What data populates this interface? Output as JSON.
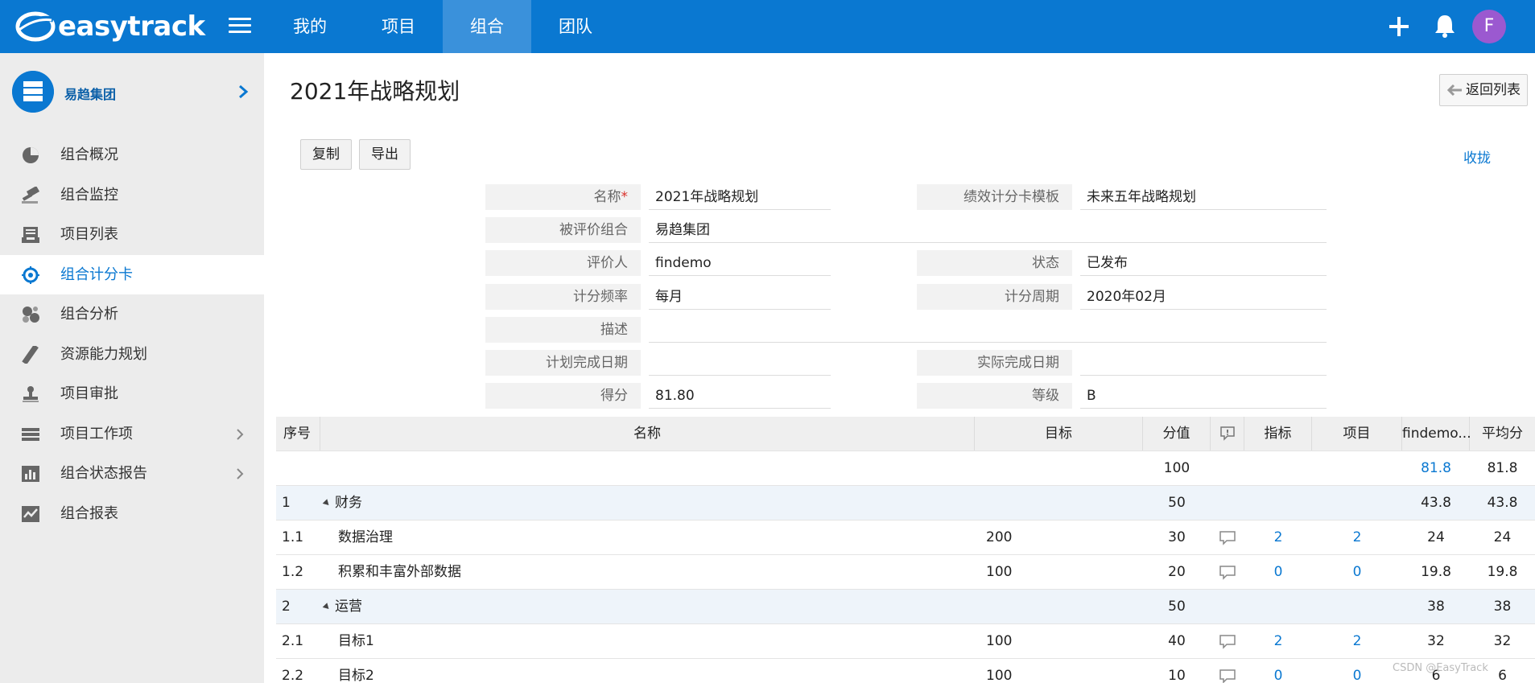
{
  "app": {
    "logo_text": "easytrack",
    "nav": [
      "我的",
      "项目",
      "组合",
      "团队"
    ],
    "active_nav": 2,
    "avatar_letter": "F",
    "accent": "#0a78d1"
  },
  "sidebar": {
    "org_name": "易趋集团",
    "items": [
      {
        "label": "组合概况",
        "icon": "pie-chart-icon"
      },
      {
        "label": "组合监控",
        "icon": "gavel-icon"
      },
      {
        "label": "项目列表",
        "icon": "inbox-icon"
      },
      {
        "label": "组合计分卡",
        "icon": "target-icon"
      },
      {
        "label": "组合分析",
        "icon": "bubbles-icon"
      },
      {
        "label": "资源能力规划",
        "icon": "ruler-icon"
      },
      {
        "label": "项目审批",
        "icon": "stamp-icon"
      },
      {
        "label": "项目工作项",
        "icon": "list-icon"
      },
      {
        "label": "组合状态报告",
        "icon": "bar-report-icon"
      },
      {
        "label": "组合报表",
        "icon": "line-report-icon"
      }
    ],
    "active_index": 3
  },
  "main": {
    "title": "2021年战略规划",
    "back_label": "返回列表",
    "copy_label": "复制",
    "export_label": "导出",
    "collapse_label": "收拢"
  },
  "form": {
    "name_label": "名称",
    "name_req": "*",
    "name_value": "2021年战略规划",
    "template_label": "绩效计分卡模板",
    "template_value": "未来五年战略规划",
    "evaluated_label": "被评价组合",
    "evaluated_value": "易趋集团",
    "evaluator_label": "评价人",
    "evaluator_value": "findemo",
    "status_label": "状态",
    "status_value": "已发布",
    "freq_label": "计分频率",
    "freq_value": "每月",
    "period_label": "计分周期",
    "period_value": "2020年02月",
    "desc_label": "描述",
    "desc_value": "",
    "plan_date_label": "计划完成日期",
    "plan_date_value": "",
    "actual_date_label": "实际完成日期",
    "actual_date_value": "",
    "score_label": "得分",
    "score_value": "81.80",
    "grade_label": "等级",
    "grade_value": "B"
  },
  "table": {
    "headers": {
      "seq": "序号",
      "name": "名称",
      "target": "目标",
      "points": "分值",
      "metric": "指标",
      "project": "项目",
      "findemo": "findemo...",
      "avg": "平均分"
    },
    "total": {
      "points": "100",
      "findemo": "81.8",
      "avg": "81.8"
    },
    "rows": [
      {
        "type": "group",
        "seq": "1",
        "name": "财务",
        "target": "",
        "points": "50",
        "metric": "",
        "project": "",
        "findemo": "43.8",
        "avg": "43.8"
      },
      {
        "type": "item",
        "seq": "1.1",
        "name": "数据治理",
        "target": "200",
        "points": "30",
        "metric": "2",
        "project": "2",
        "findemo": "24",
        "avg": "24"
      },
      {
        "type": "item",
        "seq": "1.2",
        "name": "积累和丰富外部数据",
        "target": "100",
        "points": "20",
        "metric": "0",
        "project": "0",
        "findemo": "19.8",
        "avg": "19.8"
      },
      {
        "type": "group",
        "seq": "2",
        "name": "运营",
        "target": "",
        "points": "50",
        "metric": "",
        "project": "",
        "findemo": "38",
        "avg": "38"
      },
      {
        "type": "item",
        "seq": "2.1",
        "name": "目标1",
        "target": "100",
        "points": "40",
        "metric": "2",
        "project": "2",
        "findemo": "32",
        "avg": "32"
      },
      {
        "type": "item",
        "seq": "2.2",
        "name": "目标2",
        "target": "100",
        "points": "10",
        "metric": "0",
        "project": "0",
        "findemo": "6",
        "avg": "6"
      }
    ]
  },
  "watermark": "CSDN @EasyTrack"
}
